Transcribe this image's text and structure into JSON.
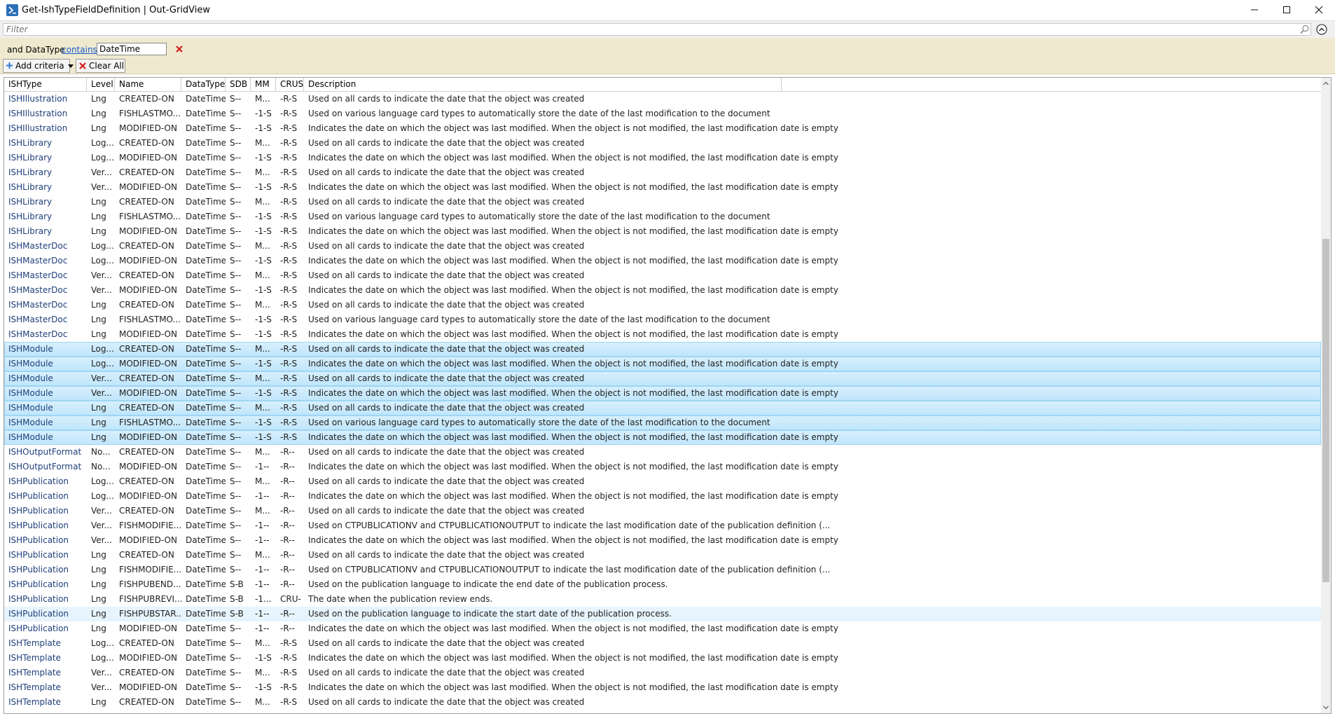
{
  "window": {
    "title": "Get-IshTypeFieldDefinition | Out-GridView",
    "icon": "powershell-icon"
  },
  "filter": {
    "placeholder": "Filter",
    "value": ""
  },
  "criteria": {
    "prefix": "and DataType",
    "operator": "contains",
    "value": "DateTime"
  },
  "buttons": {
    "add_criteria": "Add criteria",
    "clear_all": "Clear All"
  },
  "columns": [
    "ISHType",
    "Level",
    "Name",
    "DataType",
    "SDB",
    "MM",
    "CRUS",
    "Description"
  ],
  "rows": [
    {
      "type": "ISHIllustration",
      "level": "Lng",
      "name": "CREATED-ON",
      "datatype": "DateTime",
      "sdb": "S--",
      "mm": "M...",
      "crus": "-R-S",
      "desc": "Used on all cards to indicate the date that the object was created",
      "state": ""
    },
    {
      "type": "ISHIllustration",
      "level": "Lng",
      "name": "FISHLASTMO...",
      "datatype": "DateTime",
      "sdb": "S--",
      "mm": "-1-S",
      "crus": "-R-S",
      "desc": "Used on various language card types to automatically store the date of the last modification to the document",
      "state": ""
    },
    {
      "type": "ISHIllustration",
      "level": "Lng",
      "name": "MODIFIED-ON",
      "datatype": "DateTime",
      "sdb": "S--",
      "mm": "-1-S",
      "crus": "-R-S",
      "desc": "Indicates the date on which the object was last modified.  When the object is not modified, the last modification date is empty",
      "state": ""
    },
    {
      "type": "ISHLibrary",
      "level": "Log...",
      "name": "CREATED-ON",
      "datatype": "DateTime",
      "sdb": "S--",
      "mm": "M...",
      "crus": "-R-S",
      "desc": "Used on all cards to indicate the date that the object was created",
      "state": ""
    },
    {
      "type": "ISHLibrary",
      "level": "Log...",
      "name": "MODIFIED-ON",
      "datatype": "DateTime",
      "sdb": "S--",
      "mm": "-1-S",
      "crus": "-R-S",
      "desc": "Indicates the date on which the object was last modified.  When the object is not modified, the last modification date is empty",
      "state": ""
    },
    {
      "type": "ISHLibrary",
      "level": "Ver...",
      "name": "CREATED-ON",
      "datatype": "DateTime",
      "sdb": "S--",
      "mm": "M...",
      "crus": "-R-S",
      "desc": "Used on all cards to indicate the date that the object was created",
      "state": ""
    },
    {
      "type": "ISHLibrary",
      "level": "Ver...",
      "name": "MODIFIED-ON",
      "datatype": "DateTime",
      "sdb": "S--",
      "mm": "-1-S",
      "crus": "-R-S",
      "desc": "Indicates the date on which the object was last modified.  When the object is not modified, the last modification date is empty",
      "state": ""
    },
    {
      "type": "ISHLibrary",
      "level": "Lng",
      "name": "CREATED-ON",
      "datatype": "DateTime",
      "sdb": "S--",
      "mm": "M...",
      "crus": "-R-S",
      "desc": "Used on all cards to indicate the date that the object was created",
      "state": ""
    },
    {
      "type": "ISHLibrary",
      "level": "Lng",
      "name": "FISHLASTMO...",
      "datatype": "DateTime",
      "sdb": "S--",
      "mm": "-1-S",
      "crus": "-R-S",
      "desc": "Used on various language card types to automatically store the date of the last modification to the document",
      "state": ""
    },
    {
      "type": "ISHLibrary",
      "level": "Lng",
      "name": "MODIFIED-ON",
      "datatype": "DateTime",
      "sdb": "S--",
      "mm": "-1-S",
      "crus": "-R-S",
      "desc": "Indicates the date on which the object was last modified.  When the object is not modified, the last modification date is empty",
      "state": ""
    },
    {
      "type": "ISHMasterDoc",
      "level": "Log...",
      "name": "CREATED-ON",
      "datatype": "DateTime",
      "sdb": "S--",
      "mm": "M...",
      "crus": "-R-S",
      "desc": "Used on all cards to indicate the date that the object was created",
      "state": ""
    },
    {
      "type": "ISHMasterDoc",
      "level": "Log...",
      "name": "MODIFIED-ON",
      "datatype": "DateTime",
      "sdb": "S--",
      "mm": "-1-S",
      "crus": "-R-S",
      "desc": "Indicates the date on which the object was last modified.  When the object is not modified, the last modification date is empty",
      "state": ""
    },
    {
      "type": "ISHMasterDoc",
      "level": "Ver...",
      "name": "CREATED-ON",
      "datatype": "DateTime",
      "sdb": "S--",
      "mm": "M...",
      "crus": "-R-S",
      "desc": "Used on all cards to indicate the date that the object was created",
      "state": ""
    },
    {
      "type": "ISHMasterDoc",
      "level": "Ver...",
      "name": "MODIFIED-ON",
      "datatype": "DateTime",
      "sdb": "S--",
      "mm": "-1-S",
      "crus": "-R-S",
      "desc": "Indicates the date on which the object was last modified.  When the object is not modified, the last modification date is empty",
      "state": ""
    },
    {
      "type": "ISHMasterDoc",
      "level": "Lng",
      "name": "CREATED-ON",
      "datatype": "DateTime",
      "sdb": "S--",
      "mm": "M...",
      "crus": "-R-S",
      "desc": "Used on all cards to indicate the date that the object was created",
      "state": ""
    },
    {
      "type": "ISHMasterDoc",
      "level": "Lng",
      "name": "FISHLASTMO...",
      "datatype": "DateTime",
      "sdb": "S--",
      "mm": "-1-S",
      "crus": "-R-S",
      "desc": "Used on various language card types to automatically store the date of the last modification to the document",
      "state": ""
    },
    {
      "type": "ISHMasterDoc",
      "level": "Lng",
      "name": "MODIFIED-ON",
      "datatype": "DateTime",
      "sdb": "S--",
      "mm": "-1-S",
      "crus": "-R-S",
      "desc": "Indicates the date on which the object was last modified.  When the object is not modified, the last modification date is empty",
      "state": ""
    },
    {
      "type": "ISHModule",
      "level": "Log...",
      "name": "CREATED-ON",
      "datatype": "DateTime",
      "sdb": "S--",
      "mm": "M...",
      "crus": "-R-S",
      "desc": "Used on all cards to indicate the date that the object was created",
      "state": "selected"
    },
    {
      "type": "ISHModule",
      "level": "Log...",
      "name": "MODIFIED-ON",
      "datatype": "DateTime",
      "sdb": "S--",
      "mm": "-1-S",
      "crus": "-R-S",
      "desc": "Indicates the date on which the object was last modified.  When the object is not modified, the last modification date is empty",
      "state": "selected"
    },
    {
      "type": "ISHModule",
      "level": "Ver...",
      "name": "CREATED-ON",
      "datatype": "DateTime",
      "sdb": "S--",
      "mm": "M...",
      "crus": "-R-S",
      "desc": "Used on all cards to indicate the date that the object was created",
      "state": "selected"
    },
    {
      "type": "ISHModule",
      "level": "Ver...",
      "name": "MODIFIED-ON",
      "datatype": "DateTime",
      "sdb": "S--",
      "mm": "-1-S",
      "crus": "-R-S",
      "desc": "Indicates the date on which the object was last modified.  When the object is not modified, the last modification date is empty",
      "state": "selected"
    },
    {
      "type": "ISHModule",
      "level": "Lng",
      "name": "CREATED-ON",
      "datatype": "DateTime",
      "sdb": "S--",
      "mm": "M...",
      "crus": "-R-S",
      "desc": "Used on all cards to indicate the date that the object was created",
      "state": "selected"
    },
    {
      "type": "ISHModule",
      "level": "Lng",
      "name": "FISHLASTMO...",
      "datatype": "DateTime",
      "sdb": "S--",
      "mm": "-1-S",
      "crus": "-R-S",
      "desc": "Used on various language card types to automatically store the date of the last modification to the document",
      "state": "selected"
    },
    {
      "type": "ISHModule",
      "level": "Lng",
      "name": "MODIFIED-ON",
      "datatype": "DateTime",
      "sdb": "S--",
      "mm": "-1-S",
      "crus": "-R-S",
      "desc": "Indicates the date on which the object was last modified.  When the object is not modified, the last modification date is empty",
      "state": "selected"
    },
    {
      "type": "ISHOutputFormat",
      "level": "No...",
      "name": "CREATED-ON",
      "datatype": "DateTime",
      "sdb": "S--",
      "mm": "M...",
      "crus": "-R--",
      "desc": "Used on all cards to indicate the date that the object was created",
      "state": ""
    },
    {
      "type": "ISHOutputFormat",
      "level": "No...",
      "name": "MODIFIED-ON",
      "datatype": "DateTime",
      "sdb": "S--",
      "mm": "-1--",
      "crus": "-R--",
      "desc": "Indicates the date on which the object was last modified.  When the object is not modified, the last modification date is empty",
      "state": ""
    },
    {
      "type": "ISHPublication",
      "level": "Log...",
      "name": "CREATED-ON",
      "datatype": "DateTime",
      "sdb": "S--",
      "mm": "M...",
      "crus": "-R--",
      "desc": "Used on all cards to indicate the date that the object was created",
      "state": ""
    },
    {
      "type": "ISHPublication",
      "level": "Log...",
      "name": "MODIFIED-ON",
      "datatype": "DateTime",
      "sdb": "S--",
      "mm": "-1--",
      "crus": "-R--",
      "desc": "Indicates the date on which the object was last modified.  When the object is not modified, the last modification date is empty",
      "state": ""
    },
    {
      "type": "ISHPublication",
      "level": "Ver...",
      "name": "CREATED-ON",
      "datatype": "DateTime",
      "sdb": "S--",
      "mm": "M...",
      "crus": "-R--",
      "desc": "Used on all cards to indicate the date that the object was created",
      "state": ""
    },
    {
      "type": "ISHPublication",
      "level": "Ver...",
      "name": "FISHMODIFIE...",
      "datatype": "DateTime",
      "sdb": "S--",
      "mm": "-1--",
      "crus": "-R--",
      "desc": "Used on CTPUBLICATIONV and CTPUBLICATIONOUTPUT to indicate the last modification date of the publication definition (...",
      "state": ""
    },
    {
      "type": "ISHPublication",
      "level": "Ver...",
      "name": "MODIFIED-ON",
      "datatype": "DateTime",
      "sdb": "S--",
      "mm": "-1--",
      "crus": "-R--",
      "desc": "Indicates the date on which the object was last modified.  When the object is not modified, the last modification date is empty",
      "state": ""
    },
    {
      "type": "ISHPublication",
      "level": "Lng",
      "name": "CREATED-ON",
      "datatype": "DateTime",
      "sdb": "S--",
      "mm": "M...",
      "crus": "-R--",
      "desc": "Used on all cards to indicate the date that the object was created",
      "state": ""
    },
    {
      "type": "ISHPublication",
      "level": "Lng",
      "name": "FISHMODIFIE...",
      "datatype": "DateTime",
      "sdb": "S--",
      "mm": "-1--",
      "crus": "-R--",
      "desc": "Used on CTPUBLICATIONV and CTPUBLICATIONOUTPUT to indicate the last modification date of the publication definition (...",
      "state": ""
    },
    {
      "type": "ISHPublication",
      "level": "Lng",
      "name": "FISHPUBEND...",
      "datatype": "DateTime",
      "sdb": "S-B",
      "mm": "-1--",
      "crus": "-R--",
      "desc": "Used on the publication language to indicate the end date of the publication process.",
      "state": ""
    },
    {
      "type": "ISHPublication",
      "level": "Lng",
      "name": "FISHPUBREVI...",
      "datatype": "DateTime",
      "sdb": "S-B",
      "mm": "-1...",
      "crus": "CRU-",
      "desc": "The date when the publication review ends.",
      "state": ""
    },
    {
      "type": "ISHPublication",
      "level": "Lng",
      "name": "FISHPUBSTAR...",
      "datatype": "DateTime",
      "sdb": "S-B",
      "mm": "-1--",
      "crus": "-R--",
      "desc": "Used on the publication language to indicate the start date of the publication process.",
      "state": "hover"
    },
    {
      "type": "ISHPublication",
      "level": "Lng",
      "name": "MODIFIED-ON",
      "datatype": "DateTime",
      "sdb": "S--",
      "mm": "-1--",
      "crus": "-R--",
      "desc": "Indicates the date on which the object was last modified.  When the object is not modified, the last modification date is empty",
      "state": ""
    },
    {
      "type": "ISHTemplate",
      "level": "Log...",
      "name": "CREATED-ON",
      "datatype": "DateTime",
      "sdb": "S--",
      "mm": "M...",
      "crus": "-R-S",
      "desc": "Used on all cards to indicate the date that the object was created",
      "state": ""
    },
    {
      "type": "ISHTemplate",
      "level": "Log...",
      "name": "MODIFIED-ON",
      "datatype": "DateTime",
      "sdb": "S--",
      "mm": "-1-S",
      "crus": "-R-S",
      "desc": "Indicates the date on which the object was last modified.  When the object is not modified, the last modification date is empty",
      "state": ""
    },
    {
      "type": "ISHTemplate",
      "level": "Ver...",
      "name": "CREATED-ON",
      "datatype": "DateTime",
      "sdb": "S--",
      "mm": "M...",
      "crus": "-R-S",
      "desc": "Used on all cards to indicate the date that the object was created",
      "state": ""
    },
    {
      "type": "ISHTemplate",
      "level": "Ver...",
      "name": "MODIFIED-ON",
      "datatype": "DateTime",
      "sdb": "S--",
      "mm": "-1-S",
      "crus": "-R-S",
      "desc": "Indicates the date on which the object was last modified.  When the object is not modified, the last modification date is empty",
      "state": ""
    },
    {
      "type": "ISHTemplate",
      "level": "Lng",
      "name": "CREATED-ON",
      "datatype": "DateTime",
      "sdb": "S--",
      "mm": "M...",
      "crus": "-R-S",
      "desc": "Used on all cards to indicate the date that the object was created",
      "state": ""
    }
  ],
  "colors": {
    "criteria_background": "#efe9cf",
    "selection": "#bfe5fb",
    "link": "#1a5dc9",
    "remove_icon": "#d01c1c"
  }
}
